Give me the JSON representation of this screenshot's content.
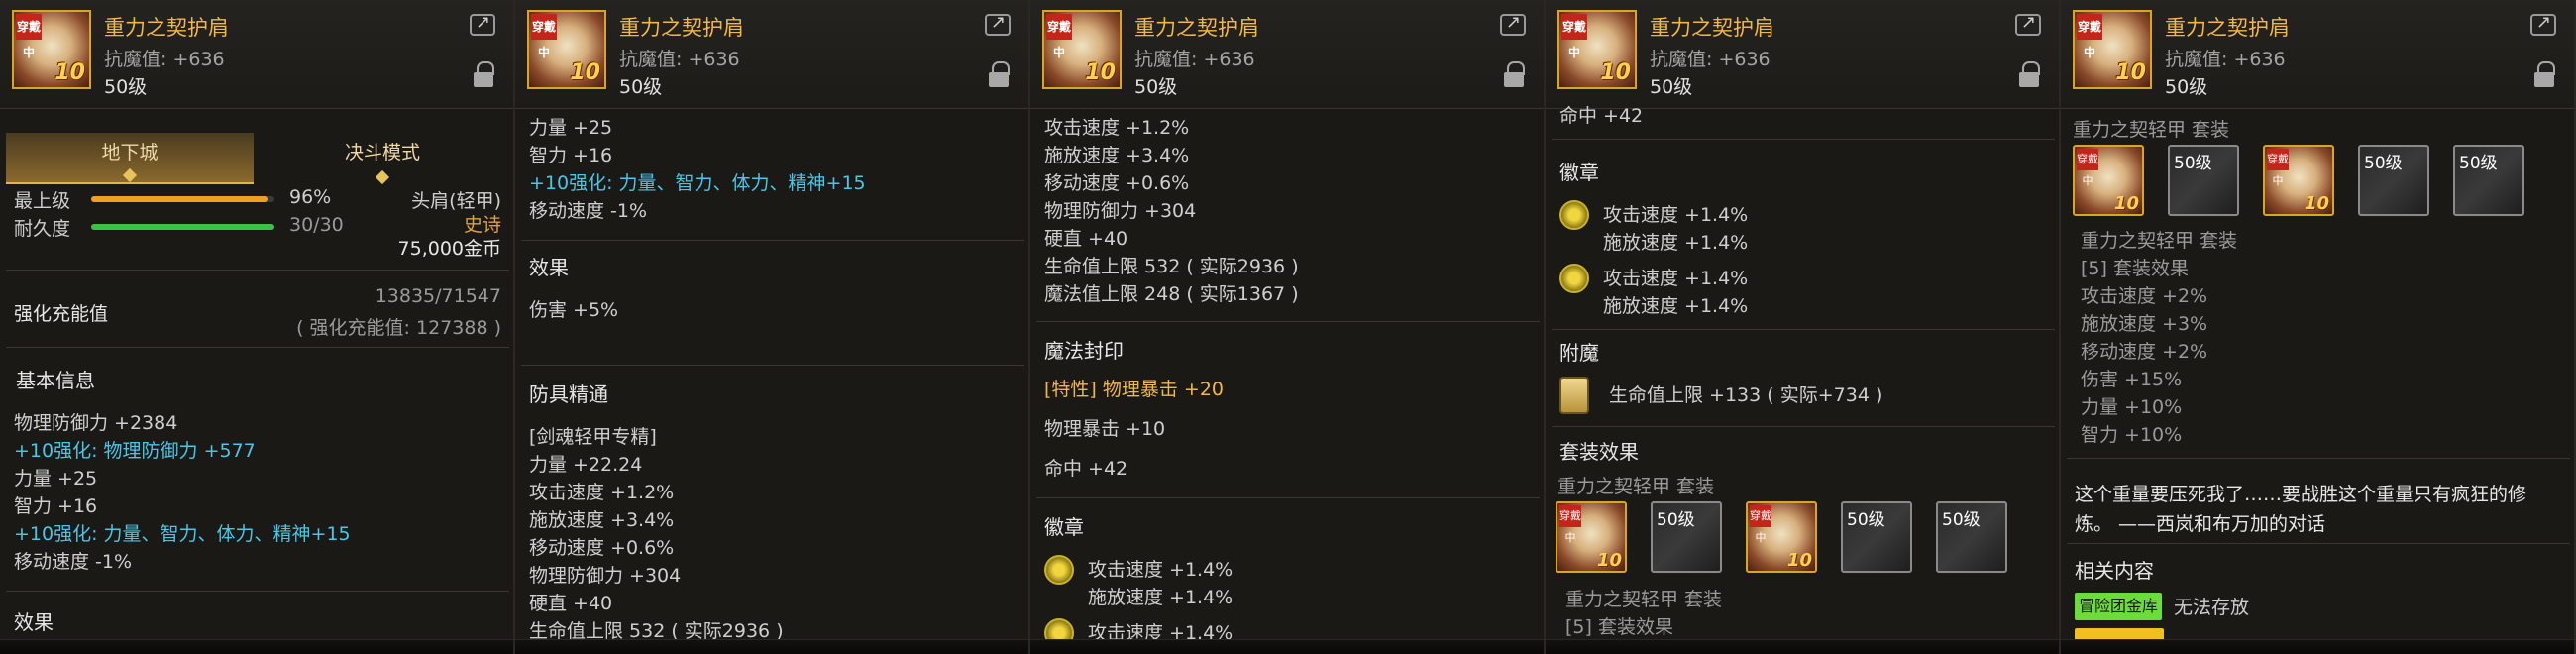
{
  "header": {
    "title": "重力之契护肩",
    "anti_magic": "抗魔值: +636",
    "level": "50级",
    "badge": "穿戴中",
    "reinforce": "10"
  },
  "panel1": {
    "tabs": [
      "地下城",
      "决斗模式"
    ],
    "max_label": "最上级",
    "max_value": "96%",
    "max_fraction": 0.96,
    "durability_label": "耐久度",
    "durability_value": "30/30",
    "durability_fraction": 1.0,
    "slot_type": "头肩(轻甲)",
    "rarity": "史诗",
    "price": "75,000金币",
    "charge_label": "强化充能值",
    "charge_value": "13835/71547",
    "charge_sub": "( 强化充能值: 127388 )",
    "basic_info": "基本信息",
    "lines": [
      {
        "text": "物理防御力 +2384",
        "color": "normal"
      },
      {
        "text": "+10强化: 物理防御力 +577",
        "color": "cyan"
      },
      {
        "text": "力量 +25",
        "color": "normal"
      },
      {
        "text": "智力 +16",
        "color": "normal"
      },
      {
        "text": "+10强化: 力量、智力、体力、精神+15",
        "color": "cyan"
      },
      {
        "text": "移动速度 -1%",
        "color": "normal"
      }
    ],
    "effect_title": "效果"
  },
  "panel2": {
    "lines_top": [
      "力量 +25",
      "智力 +16",
      "+10强化: 力量、智力、体力、精神+15",
      "移动速度 -1%"
    ],
    "effect_title": "效果",
    "effect_line": "伤害 +5%",
    "mastery_title": "防具精通",
    "mastery_tag": "[剑魂轻甲专精]",
    "mastery_lines": [
      "力量 +22.24",
      "攻击速度 +1.2%",
      "施放速度 +3.4%",
      "移动速度 +0.6%",
      "物理防御力 +304",
      "硬直 +40",
      "生命值上限 532 ( 实际2936 )"
    ]
  },
  "panel3": {
    "lines_top": [
      "攻击速度 +1.2%",
      "施放速度 +3.4%",
      "移动速度 +0.6%",
      "物理防御力 +304",
      "硬直 +40",
      "生命值上限 532 ( 实际2936 )",
      "魔法值上限 248 ( 实际1367 )"
    ],
    "seal_title": "魔法封印",
    "seal_special": "[特性] 物理暴击 +20",
    "seal_lines": [
      "物理暴击 +10",
      "命中 +42"
    ],
    "emblem_title": "徽章",
    "emblem1": [
      "攻击速度 +1.4%",
      "施放速度 +1.4%"
    ],
    "emblem2": [
      "攻击速度 +1.4%"
    ]
  },
  "panel4": {
    "top_cut": "命中 +42",
    "emblem_title": "徽章",
    "emblem1": [
      "攻击速度 +1.4%",
      "施放速度 +1.4%"
    ],
    "emblem2": [
      "攻击速度 +1.4%",
      "施放速度 +1.4%"
    ],
    "enchant_title": "附魔",
    "enchant_line": "生命值上限 +133 ( 实际+734 )",
    "set_title": "套装效果",
    "set_name": "重力之契轻甲 套装",
    "slot_label": "50级",
    "set_name2": "重力之契轻甲 套装",
    "set_count": "[5] 套装效果"
  },
  "panel5": {
    "set_name": "重力之契轻甲 套装",
    "slot_label": "50级",
    "set_name2": "重力之契轻甲 套装",
    "set_count": "[5] 套装效果",
    "set_lines": [
      "攻击速度 +2%",
      "施放速度 +3%",
      "移动速度 +2%",
      "伤害 +15%",
      "力量 +10%",
      "智力 +10%"
    ],
    "flavor_1": "这个重量要压死我了……要战胜这个重量只有疯狂的修",
    "flavor_2": "炼。 ——西岚和布万加的对话",
    "related_title": "相关内容",
    "tag_label": "冒险团金库",
    "tag_value": "无法存放"
  },
  "colors": {
    "gold": "#f2b846",
    "cyan": "#49c6e8",
    "rarity": "#e0a23a",
    "bar_orange": "#f0a020",
    "bar_green": "#3cc048"
  }
}
